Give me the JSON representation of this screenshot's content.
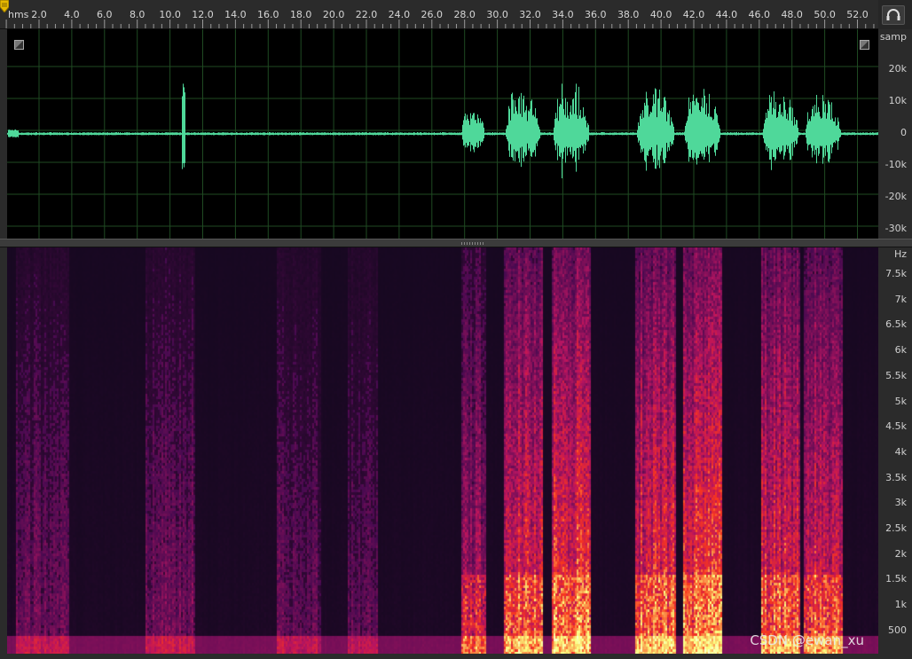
{
  "ruler": {
    "unit": "hms",
    "ticks": [
      "2.0",
      "4.0",
      "6.0",
      "8.0",
      "10.0",
      "12.0",
      "14.0",
      "16.0",
      "18.0",
      "20.0",
      "22.0",
      "24.0",
      "26.0",
      "28.0",
      "30.0",
      "32.0",
      "34.0",
      "36.0",
      "38.0",
      "40.0",
      "42.0",
      "44.0",
      "46.0",
      "48.0",
      "50.0",
      "52.0"
    ]
  },
  "waveform": {
    "scale_unit": "samp",
    "scale_labels": [
      "20k",
      "10k",
      "0",
      "-10k",
      "-20k",
      "-30k"
    ],
    "color": "#4fd89a",
    "background": "#000000"
  },
  "spectrogram": {
    "scale_unit": "Hz",
    "scale_labels": [
      "7.5k",
      "7k",
      "6.5k",
      "6k",
      "5.5k",
      "5k",
      "4.5k",
      "4k",
      "3.5k",
      "3k",
      "2.5k",
      "2k",
      "1.5k",
      "1k",
      "500"
    ]
  },
  "watermark": "CSDN @ewan_xu",
  "icons": {
    "headphone": "headphone-icon",
    "playhead": "playhead-marker-icon"
  }
}
